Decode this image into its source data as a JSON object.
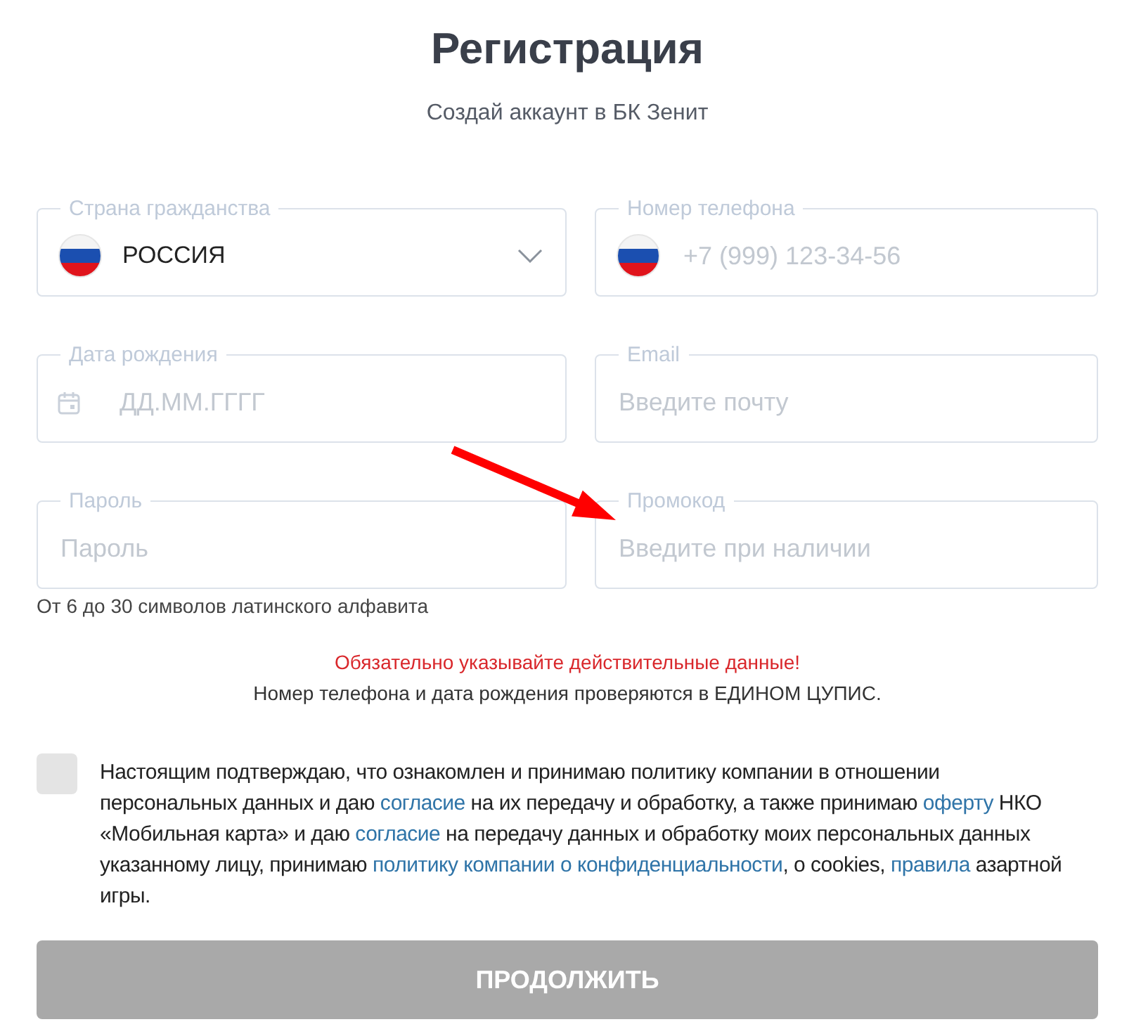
{
  "title": "Регистрация",
  "subtitle": "Создай аккаунт в БК Зенит",
  "fields": [
    {
      "kind": "select",
      "label": "Страна гражданства",
      "value": "РОССИЯ"
    },
    {
      "kind": "phone",
      "label": "Номер телефона",
      "placeholder": "+7 (999) 123-34-56"
    },
    {
      "kind": "date",
      "label": "Дата рождения",
      "placeholder": "ДД.ММ.ГГГГ"
    },
    {
      "kind": "text",
      "label": "Email",
      "placeholder": "Введите почту"
    },
    {
      "kind": "text",
      "label": "Пароль",
      "placeholder": "Пароль",
      "hint": "От 6 до 30 символов латинского алфавита"
    },
    {
      "kind": "text",
      "label": "Промокод",
      "placeholder": "Введите при наличии"
    }
  ],
  "warning": "Обязательно указывайте действительные данные!",
  "notice": "Номер телефона и дата рождения проверяются в ЕДИНОМ ЦУПИС.",
  "consent": {
    "checked": false,
    "segments": [
      {
        "text": "Настоящим подтверждаю, что ознакомлен и принимаю политику компании в отношении персональных данных и даю ",
        "link": false
      },
      {
        "text": "согласие",
        "link": true
      },
      {
        "text": " на их передачу и обработку, а также принимаю ",
        "link": false
      },
      {
        "text": "оферту",
        "link": true
      },
      {
        "text": " НКО «Мобильная карта» и даю ",
        "link": false
      },
      {
        "text": "согласие",
        "link": true
      },
      {
        "text": " на передачу данных и обработку моих персональных данных указанному лицу, принимаю ",
        "link": false
      },
      {
        "text": "политику компании о конфиденциальности",
        "link": true
      },
      {
        "text": ", о cookies, ",
        "link": false
      },
      {
        "text": "правила",
        "link": true
      },
      {
        "text": " азартной игры.",
        "link": false
      }
    ]
  },
  "submit": {
    "label": "ПРОДОЛЖИТЬ",
    "disabled": true
  }
}
